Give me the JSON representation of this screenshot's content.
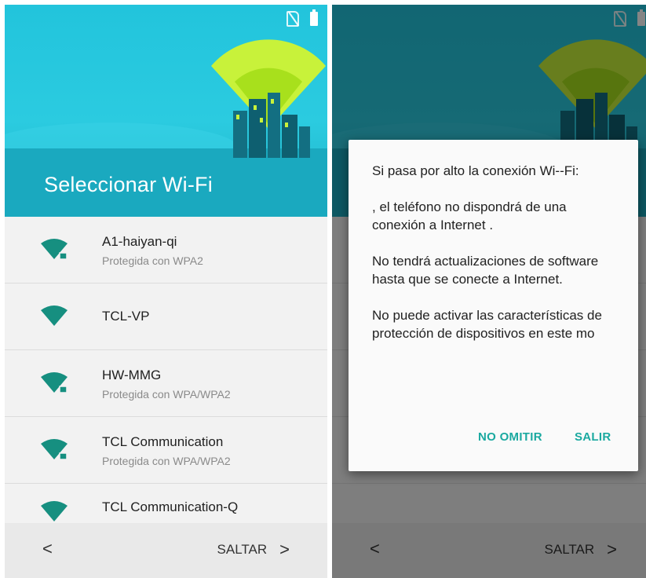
{
  "left_screen": {
    "title": "Seleccionar Wi-Fi",
    "networks": [
      {
        "name": "A1-haiyan-qi",
        "security": "Protegida con WPA2",
        "locked": true
      },
      {
        "name": "TCL-VP",
        "security": "",
        "locked": false
      },
      {
        "name": "HW-MMG",
        "security": "Protegida con WPA/WPA2",
        "locked": true
      },
      {
        "name": "TCL Communication",
        "security": "Protegida con WPA/WPA2",
        "locked": true
      },
      {
        "name": "TCL Communication-Q",
        "security": "",
        "locked": false
      }
    ],
    "bottom_bar": {
      "back_glyph": "<",
      "skip_label": "SALTAR",
      "skip_glyph": ">"
    }
  },
  "right_screen": {
    "dialog": {
      "paragraph_1": "Si pasa por alto la conexión Wi--Fi:",
      "paragraph_2": ", el teléfono no dispondrá de una conexión a Internet .",
      "paragraph_3": "No tendrá actualizaciones de software hasta que se conecte a Internet.",
      "paragraph_4": "No puede activar las características de protección de dispositivos en este mo",
      "button_no_omitir": "NO OMITIR",
      "button_salir": "SALIR"
    },
    "bottom_bar": {
      "back_glyph": "<",
      "skip_label": "SALTAR",
      "skip_glyph": ">"
    }
  },
  "colors": {
    "header": "#22c4dc",
    "header_band": "#1aa9bf",
    "accent": "#1aa9a0",
    "wifi_icon": "#168f80"
  }
}
